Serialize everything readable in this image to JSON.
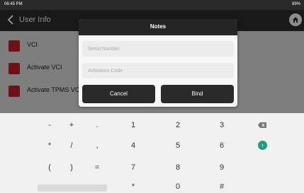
{
  "status_bar": {
    "time": "06:45 PM",
    "battery": "89%"
  },
  "app_header": {
    "title": "User Info"
  },
  "list": {
    "items": [
      {
        "label": "VCI"
      },
      {
        "label": "Activate VCI"
      },
      {
        "label": "Activate TPMS VCI"
      }
    ]
  },
  "dialog": {
    "title": "Notes",
    "serial_placeholder": "Serial Number",
    "serial_value": "",
    "activation_placeholder": "Activation Code",
    "activation_value": "",
    "cancel_label": "Cancel",
    "bind_label": "Bind"
  },
  "keyboard": {
    "row1": [
      "-",
      "+",
      ".",
      "1",
      "2",
      "3"
    ],
    "row2": [
      "*",
      "/",
      ",",
      "4",
      "5",
      "6"
    ],
    "row3": [
      "(",
      ")",
      "=",
      "7",
      "8",
      "9"
    ],
    "row4": [
      "*",
      "0",
      "#"
    ],
    "go_label": "›",
    "backspace_icon": "backspace-icon"
  },
  "colors": {
    "accent_red": "#c8202a",
    "go_green": "#1e9e7e",
    "dialog_header": "#252525"
  }
}
